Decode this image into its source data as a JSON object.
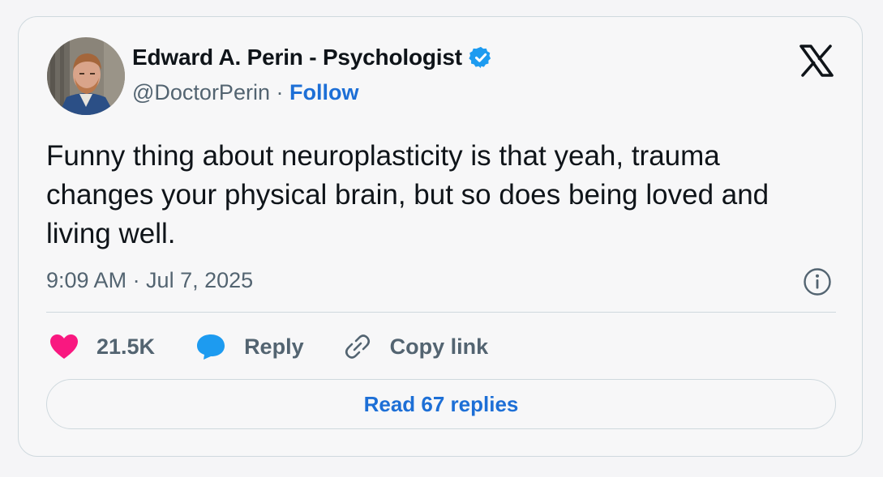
{
  "author": {
    "display_name": "Edward A. Perin - Psychologist",
    "handle": "@DoctorPerin",
    "separator": " · ",
    "follow_label": "Follow",
    "verified": true
  },
  "tweet": {
    "text": "Funny thing about neuroplasticity is that yeah, trauma changes your physical brain, but so does being loved and living well.",
    "timestamp": "9:09 AM · Jul 7, 2025"
  },
  "actions": {
    "like_count": "21.5K",
    "reply_label": "Reply",
    "copy_link_label": "Copy link"
  },
  "read_replies_label": "Read 67 replies",
  "icons": {
    "brand": "x-logo-icon",
    "verified": "verified-badge-icon",
    "info": "info-icon",
    "like": "heart-icon",
    "reply": "speech-bubble-icon",
    "copy_link": "link-icon"
  },
  "colors": {
    "link_blue": "#1d6fd6",
    "verified_blue": "#1d9bf0",
    "heart_pink": "#f91880",
    "reply_blue": "#1d9bf0",
    "muted_text": "#536471",
    "border": "#cfd9de"
  }
}
